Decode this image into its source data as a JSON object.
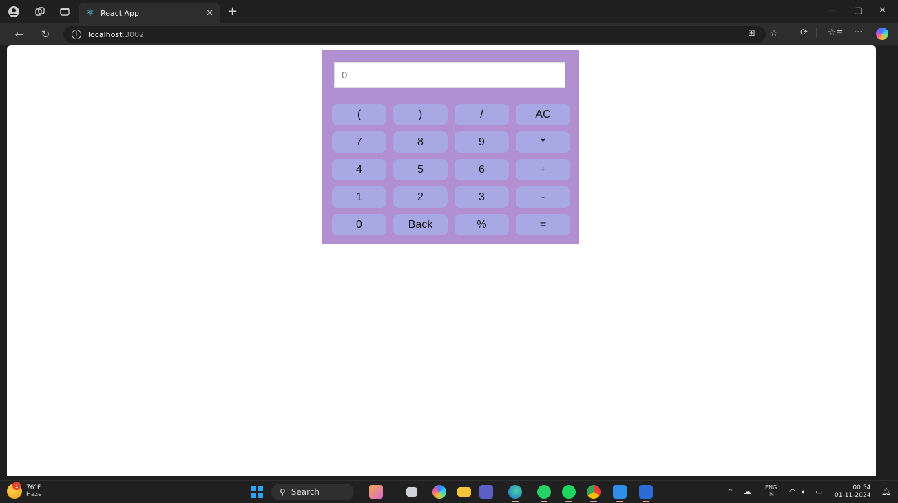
{
  "browser": {
    "tab": {
      "title": "React App"
    },
    "address": {
      "host": "localhost",
      "port": ":3002"
    }
  },
  "calculator": {
    "display_placeholder": "0",
    "display_value": "",
    "keys": [
      "(",
      ")",
      "/",
      "AC",
      "7",
      "8",
      "9",
      "*",
      "4",
      "5",
      "6",
      "+",
      "1",
      "2",
      "3",
      "-",
      "0",
      "Back",
      "%",
      "="
    ]
  },
  "taskbar": {
    "weather": {
      "temp": "76°F",
      "condition": "Haze",
      "badge": "1"
    },
    "search_label": "Search",
    "language": {
      "line1": "ENG",
      "line2": "IN"
    },
    "clock": {
      "time": "00:54",
      "date": "01-11-2024"
    }
  },
  "colors": {
    "calculator_bg": "#b18fd0",
    "key_bg": "#a8a8e4",
    "page_bg": "#ffffff"
  },
  "icons": {
    "tabbar": [
      "profile-icon",
      "workspaces-icon",
      "tab-actions-icon",
      "react-favicon",
      "close-icon",
      "new-tab-icon"
    ],
    "navbar": [
      "back-icon",
      "refresh-icon",
      "info-icon",
      "split-screen-icon",
      "favorite-star-icon",
      "extensions-icon",
      "favorites-icon",
      "more-icon",
      "copilot-icon"
    ],
    "taskbar": [
      "start-icon",
      "search-icon",
      "widgets-icon",
      "task-view-icon",
      "copilot-app-icon",
      "file-explorer-icon",
      "teams-icon",
      "edge-icon",
      "whatsapp-icon",
      "spotify-icon",
      "chrome-icon",
      "vscode-icon",
      "word-icon",
      "chevron-up-icon",
      "cloud-icon",
      "wifi-icon",
      "volume-icon",
      "battery-icon",
      "notification-icon"
    ]
  }
}
